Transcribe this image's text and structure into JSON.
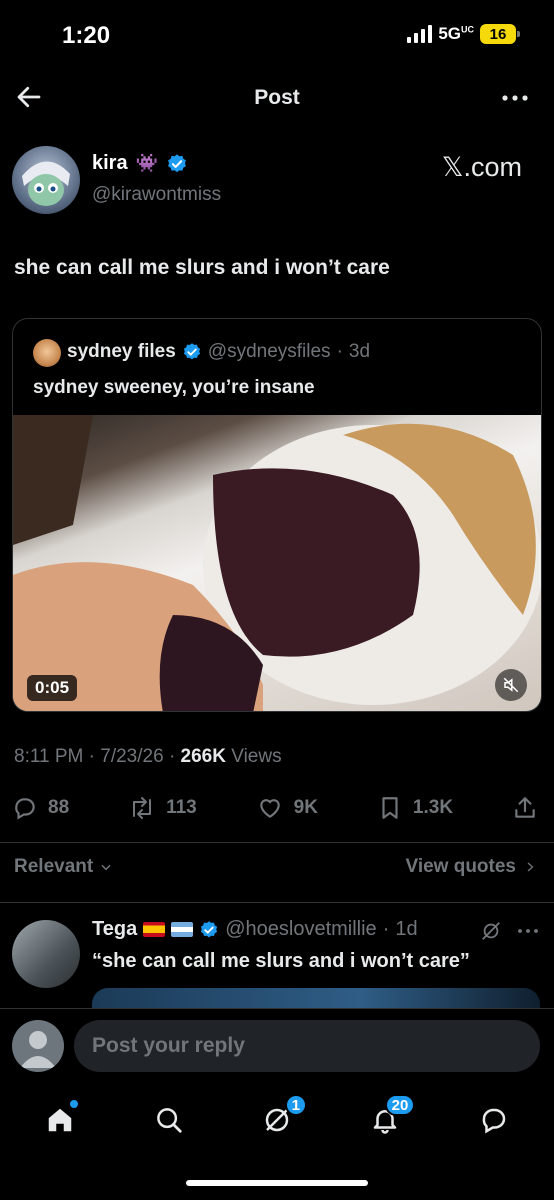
{
  "status": {
    "time": "1:20",
    "network": "5G",
    "network_sup": "UC",
    "battery": "16"
  },
  "header": {
    "title": "Post"
  },
  "author": {
    "name": "kira",
    "emoji": "👾",
    "handle": "@kirawontmiss",
    "watermark": "𝕏.com"
  },
  "post": {
    "text": "she can call me slurs and i won’t care"
  },
  "quote": {
    "name": "sydney files",
    "handle": "@sydneysfiles",
    "time": "3d",
    "text": "sydney sweeney, you’re insane",
    "video_duration": "0:05"
  },
  "meta": {
    "time": "8:11 PM",
    "date": "7/23/26",
    "views_count": "266K",
    "views_label": "Views"
  },
  "actions": {
    "replies": "88",
    "reposts": "113",
    "likes": "9K",
    "bookmarks": "1.3K"
  },
  "sort": {
    "label": "Relevant",
    "view_quotes": "View quotes"
  },
  "reply": {
    "name": "Tega",
    "handle": "@hoeslovetmillie",
    "time": "1d",
    "text": "“she can call me slurs and i won’t care”"
  },
  "composer": {
    "placeholder": "Post your reply"
  },
  "nav": {
    "messages_badge": "1",
    "notifications_badge": "20"
  },
  "colors": {
    "accent": "#1d9bf0",
    "background": "#000000",
    "muted": "#71767b",
    "text": "#e7e9ea"
  }
}
